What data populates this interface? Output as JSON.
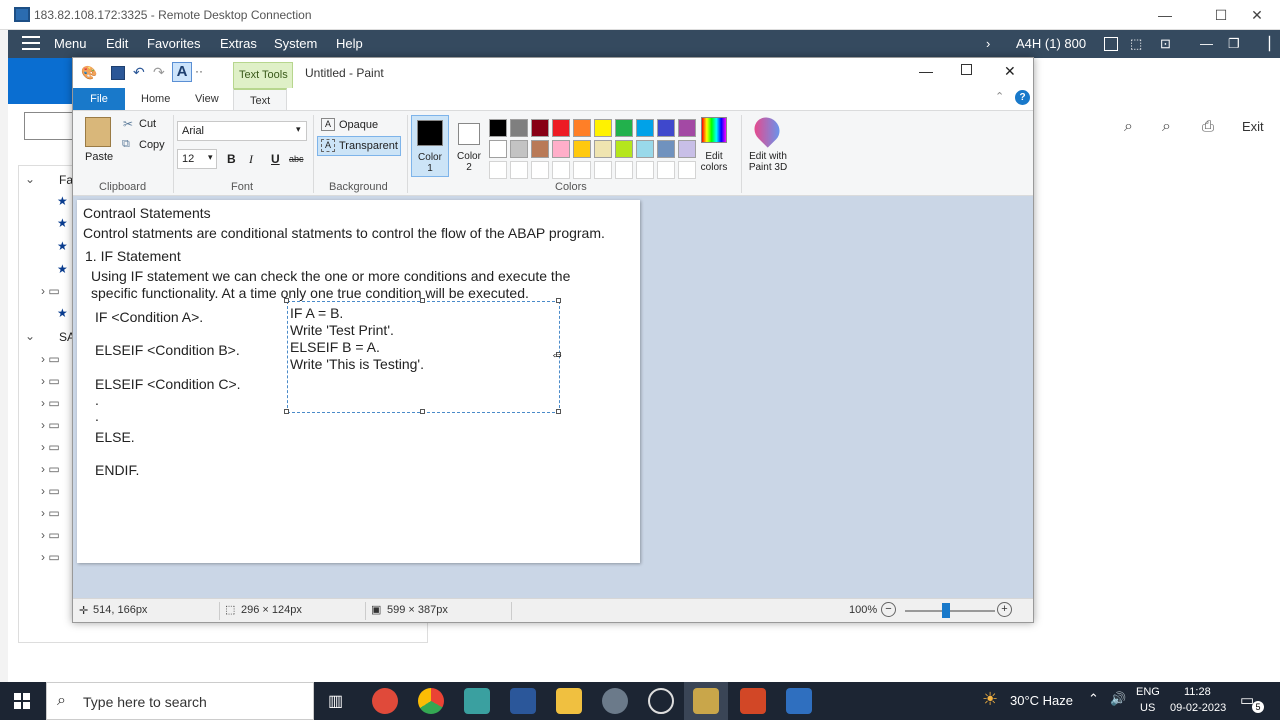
{
  "rdp": {
    "title": "183.82.108.172:3325 - Remote Desktop Connection",
    "min": "—",
    "max": "☐",
    "close": "✕"
  },
  "sap": {
    "menu": [
      "Menu",
      "Edit",
      "Favorites",
      "Extras",
      "System",
      "Help"
    ],
    "system_id": "A4H (1) 800",
    "exit_label": "Exit",
    "tree_labels": {
      "fa": "Fa",
      "sa": "SA"
    }
  },
  "paint": {
    "title": "Untitled - Paint",
    "context_tab": "Text Tools",
    "tabs": {
      "file": "File",
      "home": "Home",
      "view": "View",
      "text": "Text"
    },
    "clipboard": {
      "paste": "Paste",
      "cut": "Cut",
      "copy": "Copy",
      "group": "Clipboard"
    },
    "font": {
      "family": "Arial",
      "size": "12",
      "bold": "B",
      "italic": "I",
      "underline": "U",
      "strike": "abc",
      "group": "Font"
    },
    "background": {
      "opaque": "Opaque",
      "transparent": "Transparent",
      "group": "Background"
    },
    "colors": {
      "color1": "Color 1",
      "color2": "Color 2",
      "edit": "Edit colors",
      "paint3d": "Edit with Paint 3D",
      "group": "Colors",
      "row1": [
        "#000000",
        "#7f7f7f",
        "#880015",
        "#ed1c24",
        "#ff7f27",
        "#fff200",
        "#22b14c",
        "#00a2e8",
        "#3f48cc",
        "#a349a4"
      ],
      "row2": [
        "#ffffff",
        "#c3c3c3",
        "#b97a57",
        "#ffaec9",
        "#ffc90e",
        "#efe4b0",
        "#b5e61d",
        "#99d9ea",
        "#7092be",
        "#c8bfe7"
      ]
    },
    "canvas": {
      "heading": "Contraol Statements",
      "line1": "Control statments are conditional statments to control the flow of the ABAP program.",
      "section": "1. IF Statement",
      "para1": "Using IF statement we can check the one or more conditions and execute the",
      "para2": "specific functionality. At a time only one true condition will be executed.",
      "syntax": [
        "IF <Condition A>.",
        "ELSEIF <Condition B>.",
        "ELSEIF <Condition C>.",
        ".",
        ".",
        "ELSE.",
        "ENDIF."
      ],
      "example": [
        "IF A = B.",
        "Write 'Test Print'.",
        "ELSEIF B = A.",
        "Write 'This is Testing'."
      ]
    },
    "status": {
      "cursor": "514, 166px",
      "selection": "296 × 124px",
      "size": "599 × 387px",
      "zoom": "100%"
    }
  },
  "taskbar": {
    "search_placeholder": "Type here to search",
    "weather": "30°C  Haze",
    "lang1": "ENG",
    "lang2": "US",
    "time": "11:28",
    "date": "09-02-2023",
    "notif": "5"
  }
}
